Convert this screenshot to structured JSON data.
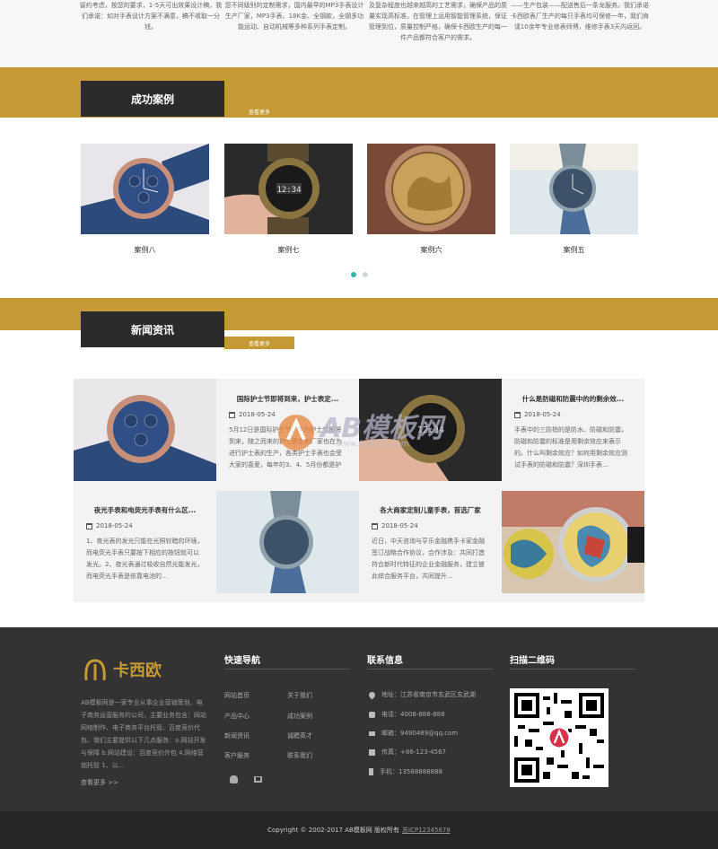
{
  "top_columns": [
    "留约考虑，按您的要求，1-5天可出效果设计稿，我们承诺：如对手表设计方案不满意，稿不收取一分钱。",
    "您不同级别的定制需求，国内最早的MP3手表设计生产厂家，MP3手表、18K金、全钢款，全钢多功能运动、自动机械等多种系列手表定制。",
    "及复杂程度也越来越高的工艺需求，确保产品的质量实现高标准。在管理上运用智能管理系统，保证管理到位，质量控制严格，确保卡西欧生产的每一件产品都符合客户的需求。",
    "——生产包装——配送售后一条龙服务。我们承诺卡西欧表厂生产的每只手表均可保修一年，我们肯请10余年专业修表师傅，维修手表3天内返回。"
  ],
  "cases_section": {
    "title": "成功案例",
    "more": "查看更多",
    "items": [
      {
        "caption": "案例八",
        "image_icon": "rose-gold-chronograph-watch"
      },
      {
        "caption": "案例七",
        "image_icon": "digital-sport-watch-in-hand"
      },
      {
        "caption": "案例六",
        "image_icon": "engraved-gold-watch-dial"
      },
      {
        "caption": "案例五",
        "image_icon": "blue-strap-watch"
      }
    ]
  },
  "news_section": {
    "title": "新闻资讯",
    "more": "查看更多",
    "items": [
      {
        "title": "国际护士节即将到来，护士表定...",
        "date": "2018-05-24",
        "summary": "5月12日是国际护士节，作为护士节即将到来，随之而来的护士表定制厂家也在为进行护士表的生产，各类护士手表也会受大家的喜爱，每年的3、4、5月份都是护士..."
      },
      {
        "title": "什么是防磁和防震中的的剩余效...",
        "date": "2018-05-24",
        "summary": "手表中的三防指的是防水、防磁和防震，防磁和防震的标准是用剩余效应来表示的。什么叫剩余效应？如何用剩余效应测试手表的防磁和防震？深圳手表..."
      },
      {
        "title": "夜光手表和电荧光手表有什么区...",
        "date": "2018-05-24",
        "summary": "1、夜光表的发光只能在光照较暗的环境，而电荧光手表只要按下相应的按钮就可以发光。2、夜光表通过吸收自然光能发光，而电荧光手表是依靠电池的..."
      },
      {
        "title": "各大商家定制儿童手表，首选厂家",
        "date": "2018-05-24",
        "summary": "近日，中天咨询与亨乐金融携手卡家金融签订战略合作协议，合作涉及：共同打造符合新时代特征的企业金融服务，建立彼此综合服务平台，共同提升..."
      }
    ]
  },
  "footer": {
    "brand": "卡西欧",
    "about": "AB模板网是一家专业从事企业营销策划、电子商务运营服务的公司，主要业务包含：网站网络制作、电子商务平台托管、百度竞价代包、我们主要提供以下几点服务：a.网站开发与保障 b.网站建设：百度竞价外包 4.网络营销托管 1、以...",
    "about_more": "查看更多 >>",
    "nav": {
      "title": "快速导航",
      "links": [
        "网站首页",
        "关于我们",
        "产品中心",
        "成功案例",
        "新闻资讯",
        "诚聘英才",
        "客户服务",
        "联系我们"
      ]
    },
    "contact": {
      "title": "联系信息",
      "items": [
        {
          "icon": "map-marker-icon",
          "text": "地址：江苏省南京市玄武区玄武湖"
        },
        {
          "icon": "phone-icon",
          "text": "电话：4008-888-888"
        },
        {
          "icon": "mail-icon",
          "text": "邮箱：9490489@qq.com"
        },
        {
          "icon": "fax-icon",
          "text": "传真：+86-123-4567"
        },
        {
          "icon": "mobile-icon",
          "text": "手机：13588888888"
        }
      ]
    },
    "qr": {
      "title": "扫描二维码"
    },
    "copyright": "Copyright © 2002-2017 AB模板网 版权所有",
    "icp": "苏ICP12345678"
  },
  "watermark": {
    "text": "AB模板网",
    "sub": "www.Admin5.com"
  },
  "colors": {
    "gold": "#c59a35",
    "dark": "#2b2b2b",
    "footer": "#333333",
    "accent_dot": "#3bb0b0"
  }
}
